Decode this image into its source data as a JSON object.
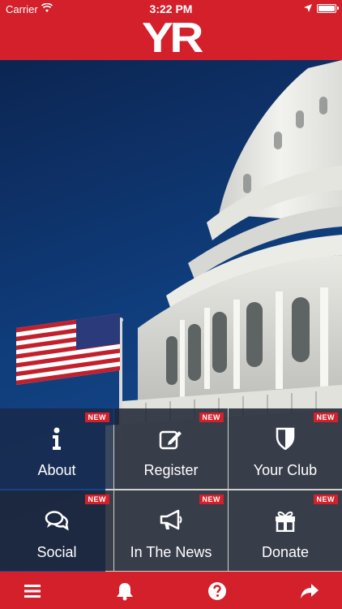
{
  "status_bar": {
    "carrier": "Carrier",
    "time": "3:22 PM",
    "icons": [
      "wifi-icon",
      "location-icon",
      "battery-icon"
    ]
  },
  "header": {
    "logo_text": "YR",
    "background_color": "#d3202b"
  },
  "hero": {
    "image": "us-capitol-dome-with-american-flag"
  },
  "tiles": [
    {
      "label": "About",
      "badge": "NEW",
      "icon": "info-icon"
    },
    {
      "label": "Register",
      "badge": "NEW",
      "icon": "edit-icon"
    },
    {
      "label": "Your Club",
      "badge": "NEW",
      "icon": "shield-icon"
    },
    {
      "label": "Social",
      "badge": "NEW",
      "icon": "chat-bubbles-icon"
    },
    {
      "label": "In The News",
      "badge": "NEW",
      "icon": "megaphone-icon"
    },
    {
      "label": "Donate",
      "badge": "NEW",
      "icon": "gift-icon"
    }
  ],
  "tab_bar": {
    "items": [
      "menu-icon",
      "bell-icon",
      "help-icon",
      "share-icon"
    ]
  },
  "colors": {
    "accent": "#d3202b",
    "tile_background": "#1e2434",
    "sky": "#0f3c7a"
  }
}
